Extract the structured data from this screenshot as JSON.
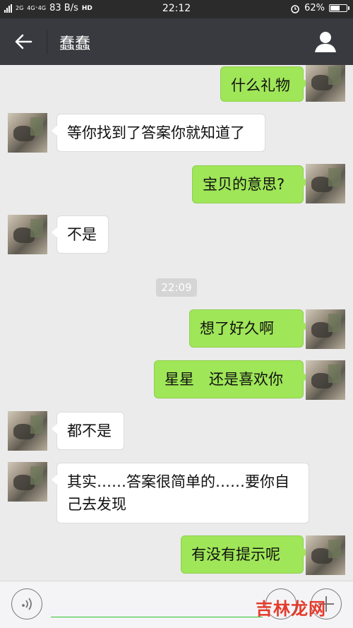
{
  "status_bar": {
    "network_1": "2G",
    "network_2": "4G⁺4G",
    "speed": "83 B/s",
    "hd": "HD",
    "time": "22:12",
    "battery_percent": "62%",
    "battery_level": 0.62
  },
  "header": {
    "back_icon": "arrow-left-icon",
    "title": "蠢蠢",
    "profile_icon": "person-icon"
  },
  "messages": [
    {
      "side": "out",
      "text": "什么礼物"
    },
    {
      "side": "in",
      "text": "等你找到了答案你就知道了"
    },
    {
      "side": "out",
      "text": "宝贝的意思?"
    },
    {
      "side": "in",
      "text": "不是"
    },
    {
      "side": "out",
      "text": "想了好久啊"
    },
    {
      "side": "out",
      "text": "星星　还是喜欢你"
    },
    {
      "side": "in",
      "text": "都不是"
    },
    {
      "side": "in",
      "text": "其实……答案很简单的……要你自己去发现"
    },
    {
      "side": "out",
      "text": "有没有提示呢"
    }
  ],
  "timestamp": "22:09",
  "input_bar": {
    "voice_icon": "voice-icon",
    "emoji_icon": "emoji-icon",
    "plus_icon": "plus-icon"
  },
  "watermark": "吉林龙网",
  "colors": {
    "out_bubble": "#9fe658",
    "in_bubble": "#ffffff",
    "navbar": "#393a3f"
  }
}
